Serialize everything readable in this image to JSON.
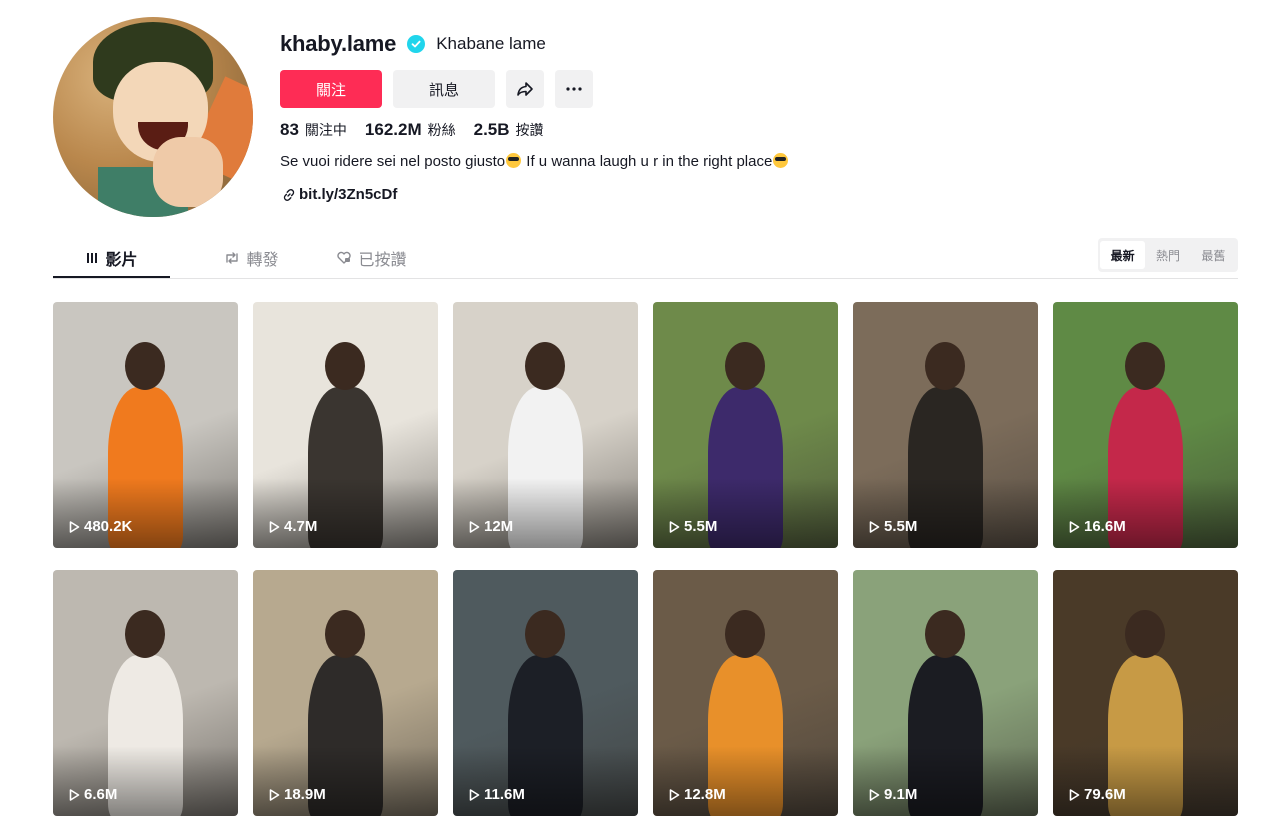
{
  "profile": {
    "username": "khaby.lame",
    "nickname": "Khabane lame",
    "follow_label": "關注",
    "message_label": "訊息",
    "stats": {
      "following_count": "83",
      "following_label": "關注中",
      "followers_count": "162.2M",
      "followers_label": "粉絲",
      "likes_count": "2.5B",
      "likes_label": "按讚"
    },
    "bio_part1": "Se vuoi ridere sei nel posto giusto",
    "bio_part2": " If u wanna laugh u r in the right place",
    "link": "bit.ly/3Zn5cDf"
  },
  "tabs": {
    "videos": "影片",
    "reposts": "轉發",
    "liked": "已按讚"
  },
  "sort": {
    "latest": "最新",
    "popular": "熱門",
    "oldest": "最舊"
  },
  "videos": [
    {
      "views": "480.2K",
      "bg": "#c9c6c0",
      "fg": "#f07a1e"
    },
    {
      "views": "4.7M",
      "bg": "#e8e4dc",
      "fg": "#3a3530"
    },
    {
      "views": "12M",
      "bg": "#d7d2c9",
      "fg": "#f2f2f2"
    },
    {
      "views": "5.5M",
      "bg": "#6e8a4a",
      "fg": "#3d2a6b"
    },
    {
      "views": "5.5M",
      "bg": "#7c6c5a",
      "fg": "#2a2622"
    },
    {
      "views": "16.6M",
      "bg": "#5f8a45",
      "fg": "#c4284a"
    },
    {
      "views": "6.6M",
      "bg": "#bdb8b0",
      "fg": "#eeeae4"
    },
    {
      "views": "18.9M",
      "bg": "#b7a98f",
      "fg": "#2e2b29"
    },
    {
      "views": "11.6M",
      "bg": "#4f5a5e",
      "fg": "#1c1f26"
    },
    {
      "views": "12.8M",
      "bg": "#6b5b48",
      "fg": "#e8902a"
    },
    {
      "views": "9.1M",
      "bg": "#8aa27a",
      "fg": "#1b1c22"
    },
    {
      "views": "79.6M",
      "bg": "#4a3a28",
      "fg": "#c79a45"
    }
  ]
}
